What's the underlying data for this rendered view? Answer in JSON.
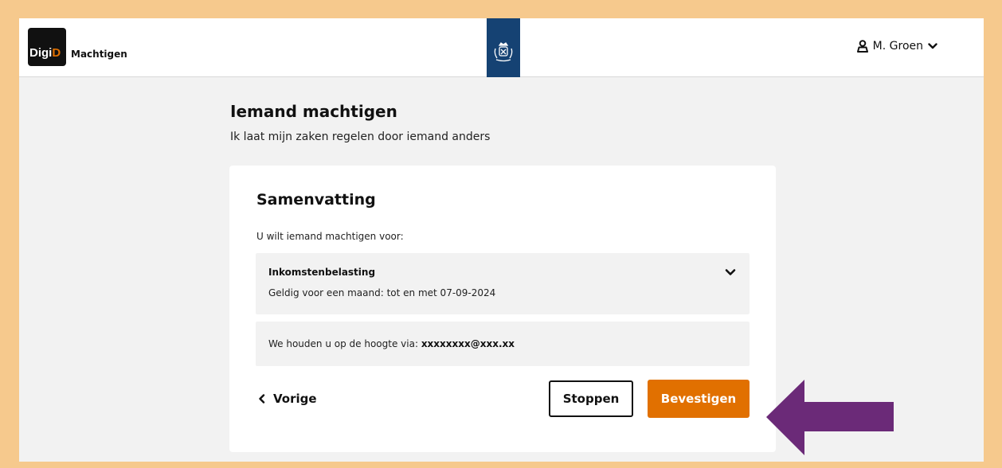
{
  "header": {
    "logo_prefix": "Digi",
    "logo_suffix": "D",
    "app_name": "Machtigen",
    "user_name": "M. Groen",
    "icons": {
      "user": "user-icon",
      "dropdown": "chevron-down-icon",
      "crest": "coat-of-arms-icon"
    }
  },
  "page": {
    "title": "Iemand machtigen",
    "subtitle": "Ik laat mijn zaken regelen door iemand anders"
  },
  "card": {
    "title": "Samenvatting",
    "intro": "U wilt iemand machtigen voor:",
    "authorization": {
      "name": "Inkomstenbelasting",
      "validity": "Geldig voor een maand: tot en met 07-09-2024"
    },
    "notification": {
      "label": "We houden u op de hoogte via:",
      "email": "xxxxxxxx@xxx.xx"
    }
  },
  "actions": {
    "back_label": "Vorige",
    "stop_label": "Stoppen",
    "confirm_label": "Bevestigen"
  },
  "colors": {
    "accent_orange": "#e17000",
    "rijksoverheid_blue": "#154273",
    "frame": "#f6c98d",
    "annotation_arrow": "#6b2a78"
  }
}
